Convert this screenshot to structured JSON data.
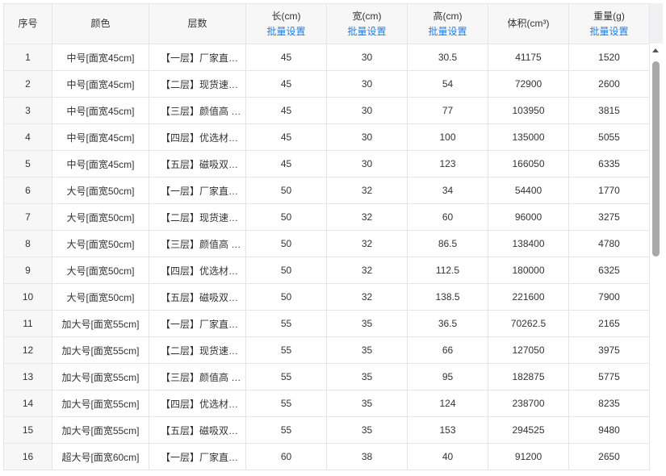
{
  "headers": {
    "index": "序号",
    "color": "颜色",
    "layers": "层数",
    "length": "长(cm)",
    "width": "宽(cm)",
    "height": "高(cm)",
    "volume": "体积(cm³)",
    "weight": "重量(g)",
    "batch_set": "批量设置"
  },
  "rows": [
    {
      "index": "1",
      "color": "中号[面宽45cm]",
      "layer": "【一层】厂家直供…",
      "length": "45",
      "width": "30",
      "height": "30.5",
      "volume": "41175",
      "weight": "1520"
    },
    {
      "index": "2",
      "color": "中号[面宽45cm]",
      "layer": "【二层】现货速发…",
      "length": "45",
      "width": "30",
      "height": "54",
      "volume": "72900",
      "weight": "2600"
    },
    {
      "index": "3",
      "color": "中号[面宽45cm]",
      "layer": "【三层】颜值高 质…",
      "length": "45",
      "width": "30",
      "height": "77",
      "volume": "103950",
      "weight": "3815"
    },
    {
      "index": "4",
      "color": "中号[面宽45cm]",
      "layer": "【四层】优选材质…",
      "length": "45",
      "width": "30",
      "height": "100",
      "volume": "135000",
      "weight": "5055"
    },
    {
      "index": "5",
      "color": "中号[面宽45cm]",
      "layer": "【五层】磁吸双开…",
      "length": "45",
      "width": "30",
      "height": "123",
      "volume": "166050",
      "weight": "6335"
    },
    {
      "index": "6",
      "color": "大号[面宽50cm]",
      "layer": "【一层】厂家直供…",
      "length": "50",
      "width": "32",
      "height": "34",
      "volume": "54400",
      "weight": "1770"
    },
    {
      "index": "7",
      "color": "大号[面宽50cm]",
      "layer": "【二层】现货速发…",
      "length": "50",
      "width": "32",
      "height": "60",
      "volume": "96000",
      "weight": "3275"
    },
    {
      "index": "8",
      "color": "大号[面宽50cm]",
      "layer": "【三层】颜值高 质…",
      "length": "50",
      "width": "32",
      "height": "86.5",
      "volume": "138400",
      "weight": "4780"
    },
    {
      "index": "9",
      "color": "大号[面宽50cm]",
      "layer": "【四层】优选材质…",
      "length": "50",
      "width": "32",
      "height": "112.5",
      "volume": "180000",
      "weight": "6325"
    },
    {
      "index": "10",
      "color": "大号[面宽50cm]",
      "layer": "【五层】磁吸双开…",
      "length": "50",
      "width": "32",
      "height": "138.5",
      "volume": "221600",
      "weight": "7900"
    },
    {
      "index": "11",
      "color": "加大号[面宽55cm]",
      "layer": "【一层】厂家直供…",
      "length": "55",
      "width": "35",
      "height": "36.5",
      "volume": "70262.5",
      "weight": "2165"
    },
    {
      "index": "12",
      "color": "加大号[面宽55cm]",
      "layer": "【二层】现货速发…",
      "length": "55",
      "width": "35",
      "height": "66",
      "volume": "127050",
      "weight": "3975"
    },
    {
      "index": "13",
      "color": "加大号[面宽55cm]",
      "layer": "【三层】颜值高 质…",
      "length": "55",
      "width": "35",
      "height": "95",
      "volume": "182875",
      "weight": "5775"
    },
    {
      "index": "14",
      "color": "加大号[面宽55cm]",
      "layer": "【四层】优选材质…",
      "length": "55",
      "width": "35",
      "height": "124",
      "volume": "238700",
      "weight": "8235"
    },
    {
      "index": "15",
      "color": "加大号[面宽55cm]",
      "layer": "【五层】磁吸双开…",
      "length": "55",
      "width": "35",
      "height": "153",
      "volume": "294525",
      "weight": "9480"
    },
    {
      "index": "16",
      "color": "超大号[面宽60cm]",
      "layer": "【一层】厂家直供…",
      "length": "60",
      "width": "38",
      "height": "40",
      "volume": "91200",
      "weight": "2650"
    }
  ],
  "icons": {
    "scroll_up": "triangle-up-icon"
  },
  "colors": {
    "link": "#1d7fe4",
    "header_bg": "#f7f7f8",
    "border": "#e4e6ea",
    "scroll_thumb": "#a8a8a8"
  }
}
